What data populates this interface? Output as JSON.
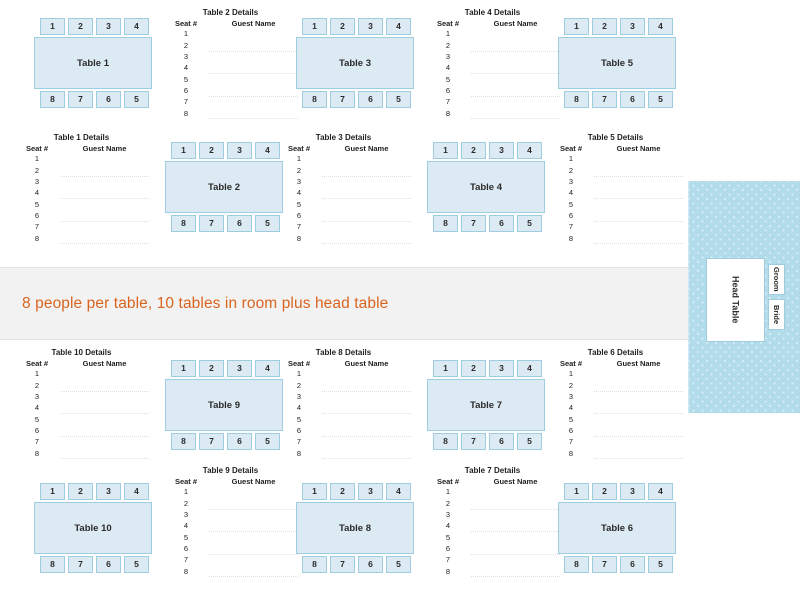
{
  "banner": {
    "text": "8 people per table, 10 tables in room plus head table",
    "accent_color": "#d9641e",
    "background_color": "#f2f2f2"
  },
  "theme": {
    "table_fill": "#dceaf3",
    "table_border": "#9ecddf",
    "panel_fill": "#b2dcea",
    "text_color": "#2b2b2b"
  },
  "details_columns": {
    "seat": "Seat #",
    "name": "Guest Name"
  },
  "seat_numbers": {
    "top": [
      "1",
      "2",
      "3",
      "4"
    ],
    "bottom": [
      "8",
      "7",
      "6",
      "5"
    ]
  },
  "seat_rows": [
    "1",
    "2",
    "3",
    "4",
    "5",
    "6",
    "7",
    "8"
  ],
  "tables": [
    {
      "label": "Table 1",
      "details_title": "Table 1 Details"
    },
    {
      "label": "Table 2",
      "details_title": "Table 2 Details"
    },
    {
      "label": "Table 3",
      "details_title": "Table 3 Details"
    },
    {
      "label": "Table 4",
      "details_title": "Table 4 Details"
    },
    {
      "label": "Table 5",
      "details_title": "Table 5 Details"
    },
    {
      "label": "Table 6",
      "details_title": "Table 6 Details"
    },
    {
      "label": "Table 7",
      "details_title": "Table 7 Details"
    },
    {
      "label": "Table 8",
      "details_title": "Table 8 Details"
    },
    {
      "label": "Table 9",
      "details_title": "Table 9 Details"
    },
    {
      "label": "Table 10",
      "details_title": "Table 10 Details"
    }
  ],
  "head_table": {
    "label": "Head Table",
    "groom_label": "Groom",
    "bride_label": "Bride"
  }
}
